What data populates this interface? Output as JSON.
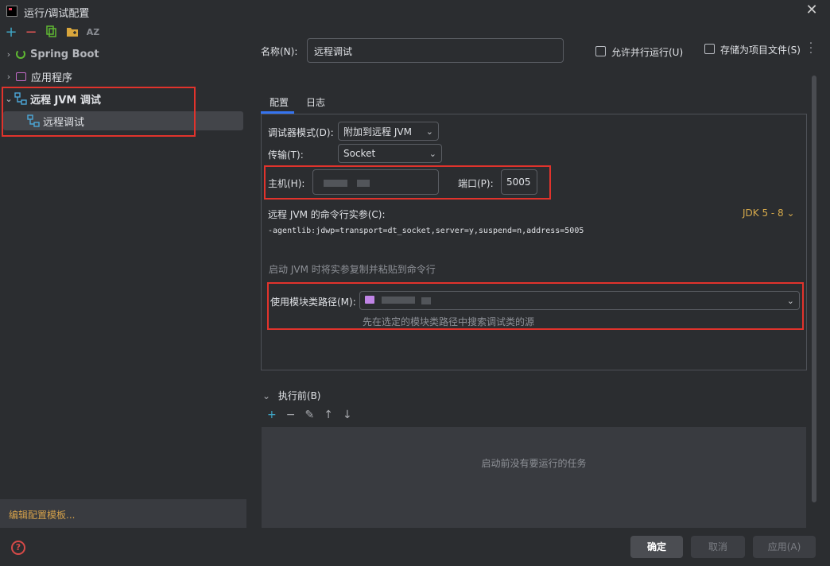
{
  "window": {
    "title": "运行/调试配置"
  },
  "sidebar": {
    "items": [
      {
        "label": "Spring Boot"
      },
      {
        "label": "应用程序"
      },
      {
        "label": "远程 JVM 调试"
      },
      {
        "label": "远程调试"
      }
    ],
    "edit_templates": "编辑配置模板..."
  },
  "form": {
    "name_label": "名称(N):",
    "name_value": "远程调试",
    "allow_parallel": "允许并行运行(U)",
    "store_as_file": "存储为项目文件(S)",
    "tabs": [
      "配置",
      "日志"
    ],
    "debugger_mode_label": "调试器模式(D):",
    "debugger_mode_value": "附加到远程 JVM",
    "transport_label": "传输(T):",
    "transport_value": "Socket",
    "host_label": "主机(H):",
    "port_label": "端口(P):",
    "port_value": "5005",
    "cmd_label": "远程 JVM 的命令行实参(C):",
    "jdk_selector": "JDK 5 - 8",
    "cmd_value": "-agentlib:jdwp=transport=dt_socket,server=y,suspend=n,address=5005",
    "copy_hint": "启动 JVM 时将实参复制并粘贴到命令行",
    "module_label": "使用模块类路径(M):",
    "module_hint": "先在选定的模块类路径中搜索调试类的源",
    "before_label": "执行前(B)",
    "before_empty": "启动前没有要运行的任务"
  },
  "buttons": {
    "ok": "确定",
    "cancel": "取消",
    "apply": "应用(A)"
  },
  "icons": {
    "toolbar": [
      "add-icon",
      "remove-icon",
      "copy-icon",
      "folder-icon",
      "sort-icon"
    ],
    "before_tools": [
      "add-icon",
      "remove-icon",
      "edit-icon",
      "move-up-icon",
      "move-down-icon"
    ]
  },
  "colors": {
    "accent": "#3574f0",
    "highlight_box": "#e1332c",
    "link": "#d4a04a"
  }
}
